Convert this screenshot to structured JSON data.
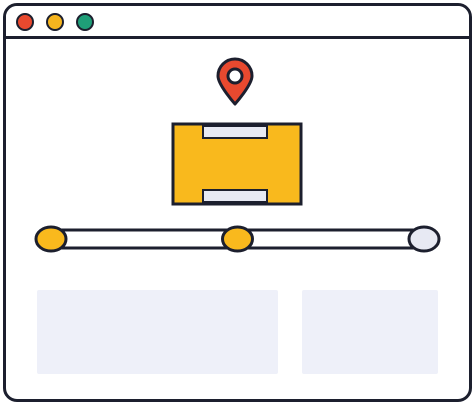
{
  "colors": {
    "outline": "#1c1f2e",
    "window_bg": "#ffffff",
    "dot_red": "#e8492f",
    "dot_yellow": "#f6b51f",
    "dot_green": "#1f9e78",
    "pin_red": "#e8492f",
    "package_yellow": "#f9b91d",
    "tape_gray": "#e7e9f3",
    "step_done": "#f9b91d",
    "step_pending": "#e7e9f3",
    "card_placeholder": "#eef0f9"
  },
  "icons": {
    "location": "map-pin-icon",
    "package": "package-box-icon"
  },
  "tracking": {
    "steps_total": 3,
    "steps_completed": 2
  }
}
